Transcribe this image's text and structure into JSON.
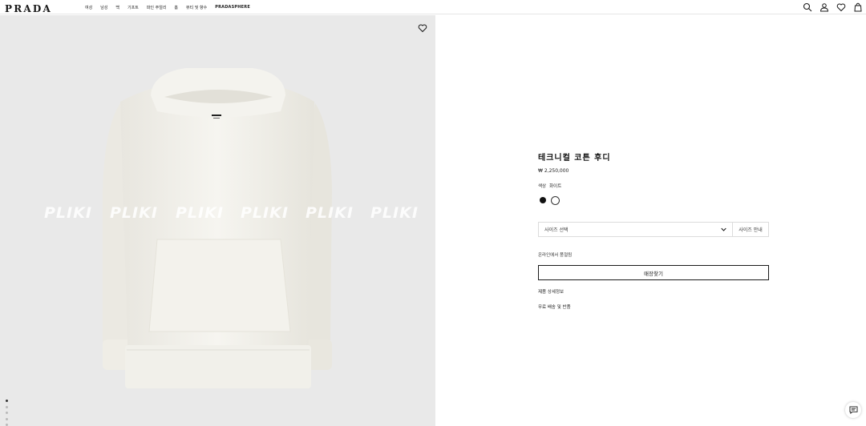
{
  "brand": {
    "logo_text": "PRADA"
  },
  "nav": {
    "items": [
      {
        "label": "여성",
        "caps": false
      },
      {
        "label": "남성",
        "caps": false
      },
      {
        "label": "백",
        "caps": false
      },
      {
        "label": "기프트",
        "caps": false
      },
      {
        "label": "파인 주얼리",
        "caps": false
      },
      {
        "label": "홈",
        "caps": false
      },
      {
        "label": "뷰티 및 향수",
        "caps": false
      },
      {
        "label": "PRADASPHERE",
        "caps": true
      }
    ]
  },
  "header_actions": [
    "search-icon",
    "account-icon",
    "wishlist-icon",
    "shopping-bag-icon"
  ],
  "gallery": {
    "watermark": "PLIKI",
    "slide_count": 5,
    "active_slide": 1,
    "wishlist_icon": "heart-icon"
  },
  "product": {
    "title": "테크니컬 코튼 후디",
    "price": "₩ 2,250,000",
    "color_label": "색상",
    "color_value": "화이트",
    "swatches": [
      {
        "name": "black",
        "color": "#111111"
      },
      {
        "name": "white",
        "color": "#ffffff",
        "selected": true
      }
    ],
    "size_select_placeholder": "사이즈 선택",
    "size_guide_label": "사이즈 안내",
    "availability_text": "온라인에서 품절됨",
    "store_button_label": "매장찾기",
    "details_link": "제품 상세정보",
    "shipping_link": "무료 배송 및 반품"
  },
  "chat": {
    "icon": "chat-icon"
  }
}
